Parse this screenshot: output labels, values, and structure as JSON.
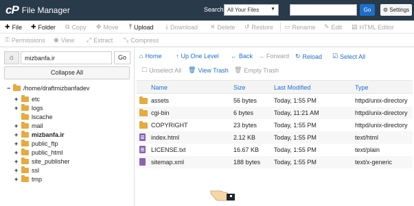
{
  "app": {
    "logo": "cP",
    "title": "File Manager"
  },
  "search": {
    "label": "Search",
    "scope": "All Your Files",
    "placeholder": "",
    "go": "Go",
    "settings": "Settings"
  },
  "toolbar1": [
    {
      "name": "new-file-button",
      "icon": "plus-icon",
      "label": "File",
      "enabled": true
    },
    {
      "name": "new-folder-button",
      "icon": "plus-icon",
      "label": "Folder",
      "enabled": true
    },
    {
      "name": "copy-button",
      "icon": "copy-icon",
      "label": "Copy",
      "enabled": false
    },
    {
      "name": "move-button",
      "icon": "move-icon",
      "label": "Move",
      "enabled": false
    },
    {
      "name": "upload-button",
      "icon": "upload-icon",
      "label": "Upload",
      "enabled": true
    },
    {
      "name": "download-button",
      "icon": "download-icon",
      "label": "Download",
      "enabled": false
    },
    {
      "name": "delete-button",
      "icon": "x-icon",
      "label": "Delete",
      "enabled": false
    },
    {
      "name": "restore-button",
      "icon": "restore-icon",
      "label": "Restore",
      "enabled": false
    },
    {
      "name": "rename-button",
      "icon": "rename-icon",
      "label": "Rename",
      "enabled": false
    },
    {
      "name": "edit-button",
      "icon": "pencil-icon",
      "label": "Edit",
      "enabled": false
    },
    {
      "name": "html-editor-button",
      "icon": "html-editor-icon",
      "label": "HTML Editor",
      "enabled": false
    }
  ],
  "toolbar2": [
    {
      "name": "permissions-button",
      "icon": "key-icon",
      "label": "Permissions",
      "enabled": false
    },
    {
      "name": "view-button",
      "icon": "eye-icon",
      "label": "View",
      "enabled": false
    },
    {
      "name": "extract-button",
      "icon": "extract-icon",
      "label": "Extract",
      "enabled": false
    },
    {
      "name": "compress-button",
      "icon": "compress-icon",
      "label": "Compress",
      "enabled": false
    }
  ],
  "left": {
    "path": "mizbanfa.ir",
    "go": "Go",
    "collapse": "Collapse All",
    "root": "/home/draftmizbanfadev",
    "tree": [
      {
        "label": "etc",
        "expandable": true,
        "bold": false
      },
      {
        "label": "logs",
        "expandable": true,
        "bold": false
      },
      {
        "label": "lscache",
        "expandable": false,
        "bold": false
      },
      {
        "label": "mail",
        "expandable": true,
        "bold": false
      },
      {
        "label": "mizbanfa.ir",
        "expandable": true,
        "bold": true
      },
      {
        "label": "public_ftp",
        "expandable": true,
        "bold": false
      },
      {
        "label": "public_html",
        "expandable": true,
        "bold": false
      },
      {
        "label": "site_publisher",
        "expandable": true,
        "bold": false
      },
      {
        "label": "ssl",
        "expandable": true,
        "bold": false
      },
      {
        "label": "tmp",
        "expandable": true,
        "bold": false
      }
    ]
  },
  "nav1": [
    {
      "name": "home-button",
      "icon": "home-icon",
      "label": "Home",
      "enabled": true
    },
    {
      "name": "up-one-level-button",
      "icon": "up-arrow-icon",
      "label": "Up One Level",
      "enabled": true
    },
    {
      "name": "back-button",
      "icon": "left-arrow-icon",
      "label": "Back",
      "enabled": true
    },
    {
      "name": "forward-button",
      "icon": "right-arrow-icon",
      "label": "Forward",
      "enabled": false
    },
    {
      "name": "reload-button",
      "icon": "reload-icon",
      "label": "Reload",
      "enabled": true
    },
    {
      "name": "select-all-button",
      "icon": "checkbox-icon",
      "label": "Select All",
      "enabled": true
    }
  ],
  "nav2": [
    {
      "name": "unselect-all-button",
      "icon": "checkbox-empty-icon",
      "label": "Unselect All",
      "enabled": false
    },
    {
      "name": "view-trash-button",
      "icon": "trash-icon",
      "label": "View Trash",
      "enabled": true
    },
    {
      "name": "empty-trash-button",
      "icon": "trash-icon",
      "label": "Empty Trash",
      "enabled": false
    }
  ],
  "table": {
    "headers": [
      "Name",
      "Size",
      "Last Modified",
      "Type"
    ],
    "rows": [
      {
        "icon": "folder-icon",
        "name": "assets",
        "size": "56 bytes",
        "modified": "Today, 1:55 PM",
        "type": "httpd/unix-directory"
      },
      {
        "icon": "folder-icon",
        "name": "cgi-bin",
        "size": "6 bytes",
        "modified": "Today, 11:21 AM",
        "type": "httpd/unix-directory"
      },
      {
        "icon": "folder-icon",
        "name": "COPYRIGHT",
        "size": "23 bytes",
        "modified": "Today, 1:55 PM",
        "type": "httpd/unix-directory"
      },
      {
        "icon": "html-file-icon",
        "name": "index.html",
        "size": "2.12 KB",
        "modified": "Today, 1:55 PM",
        "type": "text/html"
      },
      {
        "icon": "text-file-icon",
        "name": "LICENSE.txt",
        "size": "16.67 KB",
        "modified": "Today, 1:55 PM",
        "type": "text/plain"
      },
      {
        "icon": "file-icon",
        "name": "sitemap.xml",
        "size": "188 bytes",
        "modified": "Today, 1:55 PM",
        "type": "text/x-generic"
      }
    ]
  },
  "colors": {
    "topbar": "#293a4a",
    "accent": "#1a6ed0",
    "folder": "#e8a93e"
  }
}
